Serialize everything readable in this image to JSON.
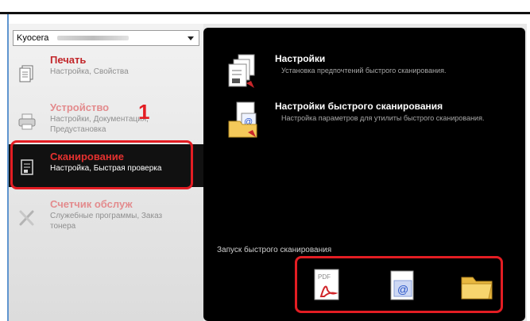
{
  "window": {
    "title": ""
  },
  "device_select": {
    "value": "Kyocera"
  },
  "sidebar": {
    "items": [
      {
        "title": "Печать",
        "subtitle": "Настройка, Свойства"
      },
      {
        "title": "Устройство",
        "subtitle": "Настройки, Документация, Предустановка"
      },
      {
        "title": "Сканирование",
        "subtitle": "Настройка, Быстрая проверка"
      },
      {
        "title": "Счетчик обслуж",
        "subtitle": "Служебные программы, Заказ тонера"
      }
    ]
  },
  "callout_number": "1",
  "main": {
    "entries": [
      {
        "title": "Настройки",
        "subtitle": "Установка предпочтений быстрого сканирования."
      },
      {
        "title": "Настройки быстрого сканирования",
        "subtitle": "Настройка параметров для утилиты быстрого сканирования."
      }
    ],
    "quick_scan_label": "Запуск быстрого сканирования",
    "quick_buttons": [
      {
        "icon": "pdf-icon",
        "label": "PDF"
      },
      {
        "icon": "email-icon",
        "label": "@"
      },
      {
        "icon": "folder-icon",
        "label": ""
      }
    ]
  },
  "colors": {
    "accent": "#e31d23",
    "title_red": "#c2262a",
    "panel": "#000000",
    "sidebar": "#e6e6e6"
  }
}
